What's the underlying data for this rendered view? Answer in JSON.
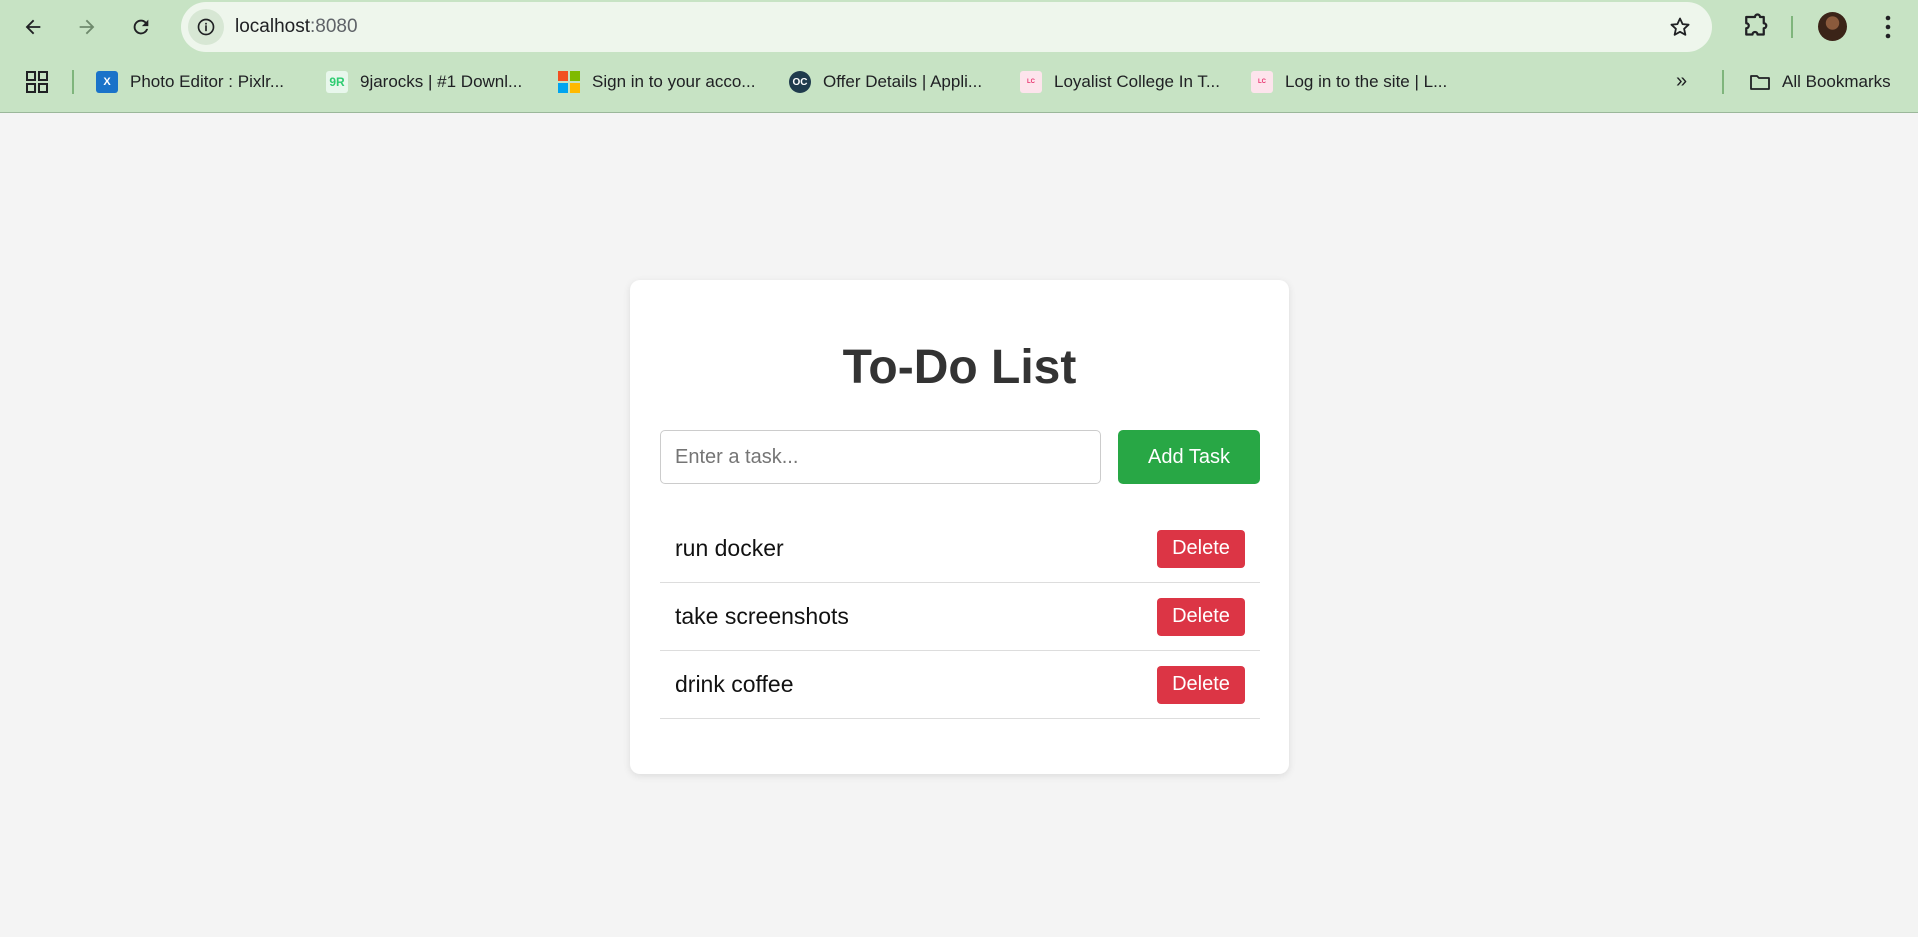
{
  "browser": {
    "url_host": "localhost",
    "url_port": ":8080",
    "bookmarks": [
      {
        "label": "Photo Editor : Pixlr...",
        "icon": "pixlr-favicon",
        "color": "#1a73c9"
      },
      {
        "label": "9jarocks | #1 Downl...",
        "icon": "9jarocks-favicon",
        "color": "#2ecc71"
      },
      {
        "label": "Sign in to your acco...",
        "icon": "microsoft-favicon",
        "color": "#f25022"
      },
      {
        "label": "Offer Details | Appli...",
        "icon": "oc-favicon",
        "color": "#1f3b4d"
      },
      {
        "label": "Loyalist College In T...",
        "icon": "loyalist-favicon",
        "color": "#e8336d"
      },
      {
        "label": "Log in to the site | L...",
        "icon": "loyalist-favicon",
        "color": "#e8336d"
      }
    ],
    "all_bookmarks": "All Bookmarks"
  },
  "app": {
    "title": "To-Do List",
    "input_placeholder": "Enter a task...",
    "add_label": "Add Task",
    "tasks": [
      {
        "text": "run docker",
        "delete_label": "Delete"
      },
      {
        "text": "take screenshots",
        "delete_label": "Delete"
      },
      {
        "text": "drink coffee",
        "delete_label": "Delete"
      }
    ],
    "colors": {
      "add": "#28a745",
      "delete": "#dc3545",
      "title": "#333333"
    }
  }
}
